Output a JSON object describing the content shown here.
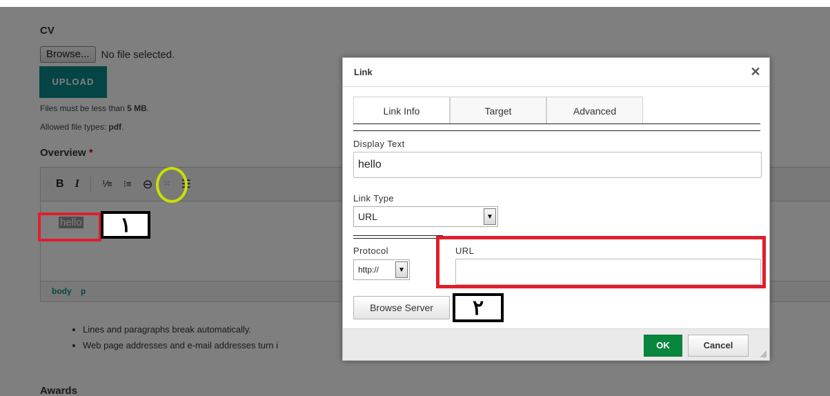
{
  "form": {
    "cv_label": "CV",
    "browse_label": "Browse...",
    "no_file_text": "No file selected.",
    "upload_label": "UPLOAD",
    "size_help_prefix": "Files must be less than ",
    "size_help_value": "5 MB",
    "size_help_suffix": ".",
    "types_help_prefix": "Allowed file types: ",
    "types_help_value": "pdf",
    "types_help_suffix": ".",
    "overview_label": "Overview",
    "required_mark": "*",
    "editor_text": "hello",
    "path_items": [
      "body",
      "p"
    ],
    "bullets": [
      "Lines and paragraphs break automatically.",
      "Web page addresses and e-mail addresses turn i"
    ],
    "awards_label": "Awards"
  },
  "toolbar": {
    "bold": "B",
    "italic": "I",
    "ordered_list": "⅟≡",
    "bullet_list": "⁝≡",
    "link": "⊖",
    "unlink": "⌗",
    "justify": "☰"
  },
  "dialog": {
    "title": "Link",
    "close": "✕",
    "tabs": [
      "Link Info",
      "Target",
      "Advanced"
    ],
    "display_text_label": "Display Text",
    "display_text_value": "hello",
    "link_type_label": "Link Type",
    "link_type_value": "URL",
    "protocol_label": "Protocol",
    "protocol_value": "http://",
    "url_label": "URL",
    "url_value": "",
    "browse_server_label": "Browse Server",
    "ok_label": "OK",
    "cancel_label": "Cancel"
  },
  "annotations": {
    "step1": "١",
    "step2": "٢",
    "highlight_color": "#e21d2b",
    "circle_color": "#c8e000"
  }
}
